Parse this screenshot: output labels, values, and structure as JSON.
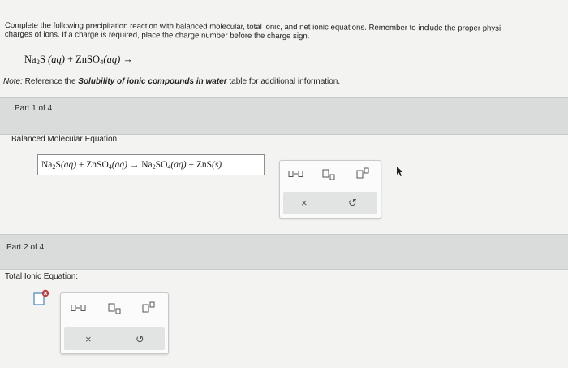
{
  "instructions": {
    "line1": "Complete the following precipitation reaction with balanced molecular, total ionic, and net ionic equations. Remember to include the proper physi",
    "line2": "charges of ions. If a charge is required, place the charge number before the charge sign."
  },
  "reaction": {
    "reactant1": "Na",
    "reactant1_sub": "2",
    "reactant1_rest": "S",
    "reactant1_state": "(aq)",
    "plus": "+",
    "reactant2": "ZnSO",
    "reactant2_sub": "4",
    "reactant2_state": "(aq)",
    "arrow": "→"
  },
  "note": {
    "prefix": "Note:",
    "text1": " Reference the ",
    "emph": "Solubility of ionic compounds in water",
    "text2": " table for additional information."
  },
  "part1": {
    "label": "Part 1 of 4",
    "section": "Balanced Molecular Equation:",
    "answer": {
      "a1": "Na",
      "a1s": "2",
      "a1r": "S",
      "a1st": "(aq)",
      "plus1": " + ",
      "a2": "ZnSO",
      "a2s": "4",
      "a2st": "(aq)",
      "arrow": " → ",
      "p1": "Na",
      "p1s": "2",
      "p1r": "SO",
      "p1s2": "4",
      "p1st": "(aq)",
      "plus2": " + ",
      "p2": "ZnS",
      "p2st": "(s)"
    }
  },
  "part2": {
    "label": "Part 2 of 4",
    "section": "Total Ionic Equation:"
  },
  "toolbox": {
    "icons": [
      "reaction-arrow-icon",
      "subscript-icon",
      "superscript-icon",
      "clear-icon",
      "undo-icon"
    ],
    "clear": "×",
    "undo": "↺"
  }
}
